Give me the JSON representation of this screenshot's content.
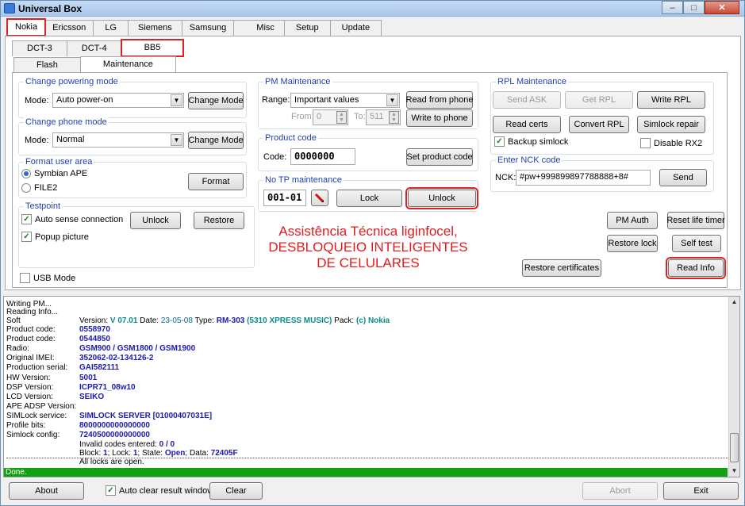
{
  "window": {
    "title": "Universal Box"
  },
  "top_tabs": [
    "Nokia",
    "Ericsson",
    "LG",
    "Siemens",
    "Samsung",
    "Misc",
    "Setup",
    "Update"
  ],
  "sub_tabs": [
    "DCT-3",
    "DCT-4",
    "BB5"
  ],
  "mode_tabs": [
    "Flash",
    "Maintenance"
  ],
  "powering": {
    "title": "Change powering mode",
    "mode_label": "Mode:",
    "value": "Auto power-on",
    "button": "Change Mode"
  },
  "phone_mode": {
    "title": "Change phone mode",
    "mode_label": "Mode:",
    "value": "Normal",
    "button": "Change Mode"
  },
  "format": {
    "title": "Format user area",
    "option1": "Symbian APE",
    "option2": "FILE2",
    "button": "Format"
  },
  "testpoint": {
    "title": "Testpoint",
    "auto_sense": "Auto sense connection",
    "popup": "Popup picture",
    "unlock": "Unlock",
    "restore": "Restore"
  },
  "usb_mode": "USB Mode",
  "pm": {
    "title": "PM Maintenance",
    "range_label": "Range:",
    "range_value": "Important values",
    "from_label": "From:",
    "from_value": "0",
    "to_label": "To:",
    "to_value": "511",
    "read": "Read from phone",
    "write": "Write to phone"
  },
  "product": {
    "title": "Product code",
    "code_label": "Code:",
    "code_value": "0000000",
    "button": "Set product code"
  },
  "notp": {
    "title": "No TP maintenance",
    "value": "001-01",
    "lock": "Lock",
    "unlock": "Unlock"
  },
  "watermark": [
    "Assistência Técnica liginfocel,",
    "DESBLOQUEIO INTELIGENTES",
    "DE CELULARES"
  ],
  "rpl": {
    "title": "RPL Maintenance",
    "send_ask": "Send ASK",
    "get_rpl": "Get RPL",
    "write_rpl": "Write RPL",
    "read_certs": "Read certs",
    "convert_rpl": "Convert RPL",
    "simlock_repair": "Simlock repair",
    "backup_simlock": "Backup simlock",
    "disable_rx2": "Disable RX2"
  },
  "nck": {
    "title": "Enter NCK code",
    "label": "NCK:",
    "value": "#pw+999899897788888+8#",
    "send": "Send"
  },
  "actions": {
    "pm_auth": "PM Auth",
    "reset_timer": "Reset life timer",
    "restore_lock": "Restore lock",
    "self_test": "Self test",
    "restore_certs": "Restore certificates",
    "read_info": "Read Info"
  },
  "log": {
    "line1": "Writing PM...",
    "line2": "Reading Info...",
    "soft_key": "Soft",
    "soft_a": "Version: ",
    "soft_ver": "V 07.01",
    "soft_b": " Date: ",
    "soft_date": "23-05-08",
    "soft_c": " Type: ",
    "soft_type": "RM-303",
    "soft_model": " (5310 XPRESS MUSIC)",
    "soft_d": " Pack: ",
    "soft_pack": "(c) Nokia",
    "rows": [
      {
        "k": "Product code:",
        "v": "0558970"
      },
      {
        "k": "Product code:",
        "v": "0544850"
      },
      {
        "k": "Radio:",
        "v": "GSM900 / GSM1800 / GSM1900"
      },
      {
        "k": "Original IMEI:",
        "v": "352062-02-134126-2"
      },
      {
        "k": "Production serial:",
        "v": "GAI582111"
      },
      {
        "k": "HW Version:",
        "v": "5001"
      },
      {
        "k": "DSP Version:",
        "v": "ICPR71_08w10"
      },
      {
        "k": "LCD Version:",
        "v": "SEIKO"
      },
      {
        "k": "APE ADSP Version:",
        "v": ""
      },
      {
        "k": "SIMLock service:",
        "v": "SIMLOCK SERVER [01000407031E]"
      },
      {
        "k": "Profile bits:",
        "v": "8000000000000000"
      },
      {
        "k": "Simlock config:",
        "v": "7240500000000000"
      }
    ],
    "invalid_a": "Invalid codes entered: ",
    "invalid_v": "0 / 0",
    "block_a": "Block: ",
    "block_v": "1",
    "lock_a": "; Lock: ",
    "lock_v": "1",
    "state_a": "; State: ",
    "state_v": "Open",
    "data_a": "; Data: ",
    "data_v": "72405F",
    "all_open": "All locks are open.",
    "status": "Done."
  },
  "bottom": {
    "about": "About",
    "auto_clear": "Auto clear result window",
    "clear": "Clear",
    "abort": "Abort",
    "exit": "Exit"
  }
}
